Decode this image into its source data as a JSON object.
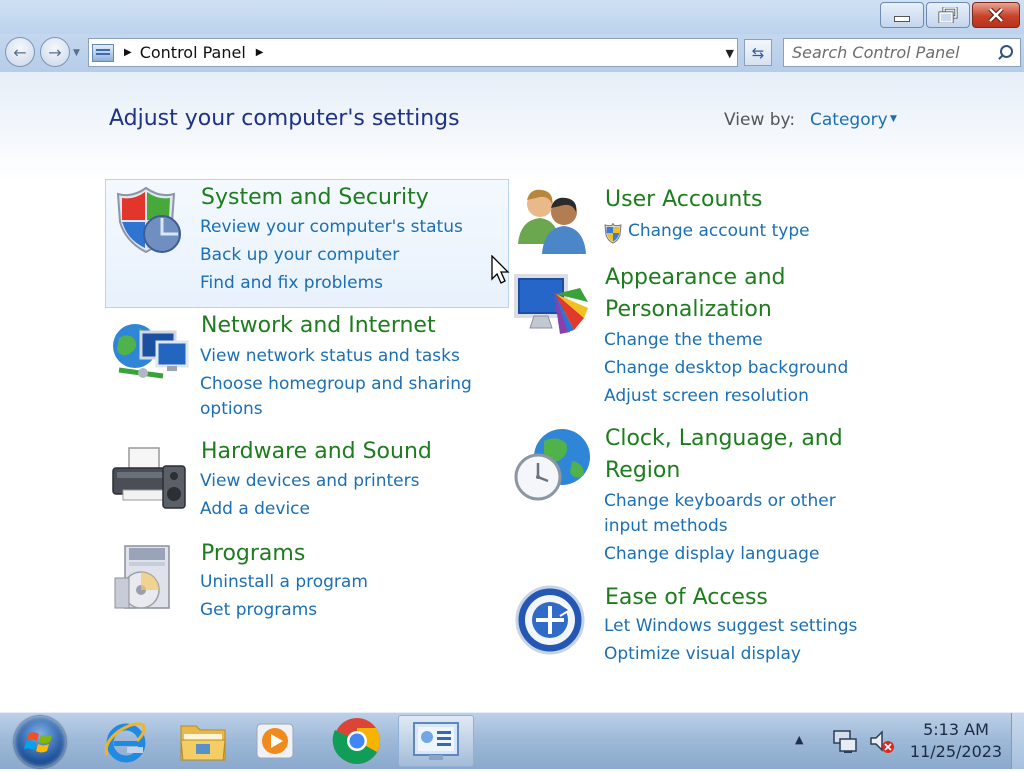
{
  "window": {
    "controls": {
      "minimize": "minimize",
      "maximize": "restore",
      "close": "close"
    }
  },
  "address_bar": {
    "breadcrumb": [
      "Control Panel"
    ],
    "search_placeholder": "Search Control Panel"
  },
  "header": {
    "title": "Adjust your computer's settings",
    "view_by_label": "View by:",
    "view_by_value": "Category"
  },
  "categories": [
    {
      "title": "System and Security",
      "icon": "shield-icon",
      "links": [
        "Review your computer's status",
        "Back up your computer",
        "Find and fix problems"
      ]
    },
    {
      "title": "Network and Internet",
      "icon": "network-icon",
      "links": [
        "View network status and tasks",
        "Choose homegroup and sharing options"
      ]
    },
    {
      "title": "Hardware and Sound",
      "icon": "printer-icon",
      "links": [
        "View devices and printers",
        "Add a device"
      ]
    },
    {
      "title": "Programs",
      "icon": "programs-icon",
      "links": [
        "Uninstall a program",
        "Get programs"
      ]
    },
    {
      "title": "User Accounts",
      "icon": "users-icon",
      "links": [
        "Change account type"
      ]
    },
    {
      "title": "Appearance and Personalization",
      "icon": "monitor-palette-icon",
      "links": [
        "Change the theme",
        "Change desktop background",
        "Adjust screen resolution"
      ]
    },
    {
      "title": "Clock, Language, and Region",
      "icon": "globe-clock-icon",
      "links": [
        "Change keyboards or other input methods",
        "Change display language"
      ]
    },
    {
      "title": "Ease of Access",
      "icon": "ease-of-access-icon",
      "links": [
        "Let Windows suggest settings",
        "Optimize visual display"
      ]
    }
  ],
  "taskbar": {
    "apps": [
      "internet-explorer",
      "windows-explorer",
      "windows-media-player",
      "google-chrome",
      "control-panel"
    ],
    "clock_time": "5:13 AM",
    "clock_date": "11/25/2023"
  }
}
